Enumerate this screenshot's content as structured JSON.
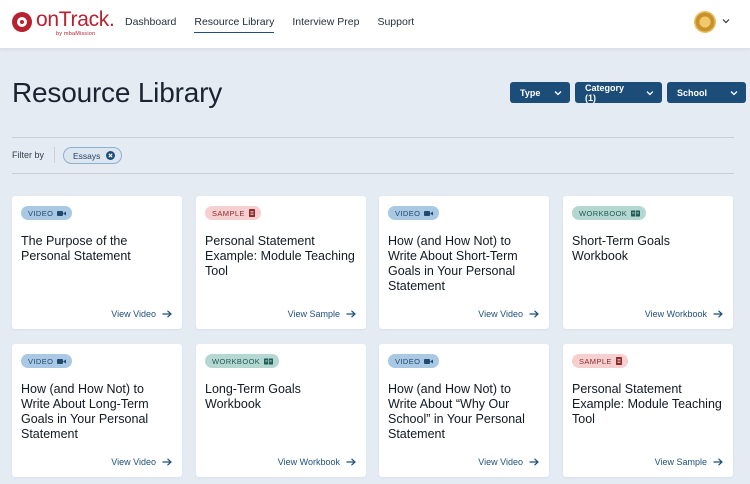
{
  "brand": {
    "name": "onTrack.",
    "tagline": "by mbaMission",
    "color": "#b8212f"
  },
  "nav": {
    "items": [
      {
        "label": "Dashboard",
        "active": false
      },
      {
        "label": "Resource Library",
        "active": true
      },
      {
        "label": "Interview Prep",
        "active": false
      },
      {
        "label": "Support",
        "active": false
      }
    ]
  },
  "page": {
    "title": "Resource Library"
  },
  "filters": {
    "type_label": "Type",
    "category_label": "Category (1)",
    "school_label": "School",
    "filter_by_label": "Filter by",
    "active_chip": "Essays"
  },
  "colors": {
    "primary": "#1c4d79",
    "video_badge": "#a9c8e4",
    "sample_badge": "#f6cfd0",
    "workbook_badge": "#b4d7d2"
  },
  "cards": [
    {
      "badge": "VIDEO",
      "badge_icon": "video-camera-icon",
      "title": "The Purpose of the Personal Statement",
      "link": "View Video"
    },
    {
      "badge": "SAMPLE",
      "badge_icon": "document-icon",
      "title": "Personal Statement Example: Module Teaching Tool",
      "link": "View Sample"
    },
    {
      "badge": "VIDEO",
      "badge_icon": "video-camera-icon",
      "title": "How (and How Not) to Write About Short-Term Goals in Your Personal Statement",
      "link": "View Video"
    },
    {
      "badge": "WORKBOOK",
      "badge_icon": "book-icon",
      "title": "Short-Term Goals Workbook",
      "link": "View Workbook"
    },
    {
      "badge": "VIDEO",
      "badge_icon": "video-camera-icon",
      "title": "How (and How Not) to Write About Long-Term Goals in Your Personal Statement",
      "link": "View Video"
    },
    {
      "badge": "WORKBOOK",
      "badge_icon": "book-icon",
      "title": "Long-Term Goals Workbook",
      "link": "View Workbook"
    },
    {
      "badge": "VIDEO",
      "badge_icon": "video-camera-icon",
      "title": "How (and How Not) to Write About “Why Our School” in Your Personal Statement",
      "link": "View Video"
    },
    {
      "badge": "SAMPLE",
      "badge_icon": "document-icon",
      "title": "Personal Statement Example: Module Teaching Tool",
      "link": "View Sample"
    }
  ]
}
